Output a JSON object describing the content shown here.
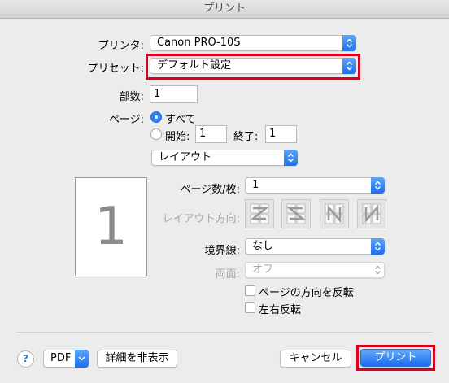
{
  "window": {
    "title": "プリント"
  },
  "printer": {
    "label": "プリンタ:",
    "value": "Canon PRO-10S"
  },
  "preset": {
    "label": "プリセット:",
    "value": "デフォルト設定"
  },
  "copies": {
    "label": "部数:",
    "value": "1"
  },
  "pages": {
    "label": "ページ:",
    "all_label": "すべて",
    "from_label": "開始:",
    "from_value": "1",
    "to_label": "終了:",
    "to_value": "1"
  },
  "section": {
    "value": "レイアウト"
  },
  "preview": {
    "page_number": "1"
  },
  "layout": {
    "pages_per_sheet_label": "ページ数/枚:",
    "pages_per_sheet_value": "1",
    "direction_label": "レイアウト方向:",
    "border_label": "境界線:",
    "border_value": "なし",
    "two_sided_label": "両面:",
    "two_sided_value": "オフ",
    "reverse_orientation_label": "ページの方向を反転",
    "flip_horizontal_label": "左右反転"
  },
  "footer": {
    "help": "?",
    "pdf": "PDF",
    "hide_details": "詳細を非表示",
    "cancel": "キャンセル",
    "print": "プリント"
  },
  "colors": {
    "accent": "#1a6df0",
    "highlight": "#d9001b"
  }
}
